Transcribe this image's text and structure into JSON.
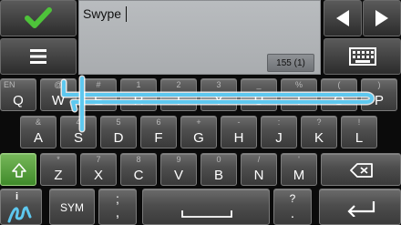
{
  "input": {
    "text": "Swype",
    "counter": "155 (1)"
  },
  "keyboard": {
    "row1": [
      {
        "main": "Q",
        "sec": "EN"
      },
      {
        "main": "W",
        "sec": "@"
      },
      {
        "main": "E",
        "sec": "#"
      },
      {
        "main": "R",
        "sec": "1"
      },
      {
        "main": "T",
        "sec": "2"
      },
      {
        "main": "Y",
        "sec": "3"
      },
      {
        "main": "U",
        "sec": "_"
      },
      {
        "main": "I",
        "sec": "%"
      },
      {
        "main": "O",
        "sec": "("
      },
      {
        "main": "P",
        "sec": ")"
      }
    ],
    "row2": [
      {
        "main": "A",
        "sec": "&"
      },
      {
        "main": "S",
        "sec": "4"
      },
      {
        "main": "D",
        "sec": "5"
      },
      {
        "main": "F",
        "sec": "6"
      },
      {
        "main": "G",
        "sec": "+"
      },
      {
        "main": "H",
        "sec": "-"
      },
      {
        "main": "J",
        "sec": ":"
      },
      {
        "main": "K",
        "sec": "?"
      },
      {
        "main": "L",
        "sec": "!"
      }
    ],
    "row3": [
      {
        "main": "Z",
        "sec": "*"
      },
      {
        "main": "X",
        "sec": "7"
      },
      {
        "main": "C",
        "sec": "8"
      },
      {
        "main": "V",
        "sec": "9"
      },
      {
        "main": "B",
        "sec": "0"
      },
      {
        "main": "N",
        "sec": "/"
      },
      {
        "main": "M",
        "sec": "'"
      }
    ],
    "sym_label": "SYM",
    "comma": ",",
    "comma_sec": ";",
    "period": ".",
    "period_sec": "?"
  },
  "colors": {
    "trace": "#5ec8ef",
    "accent": "#4ec33a"
  }
}
